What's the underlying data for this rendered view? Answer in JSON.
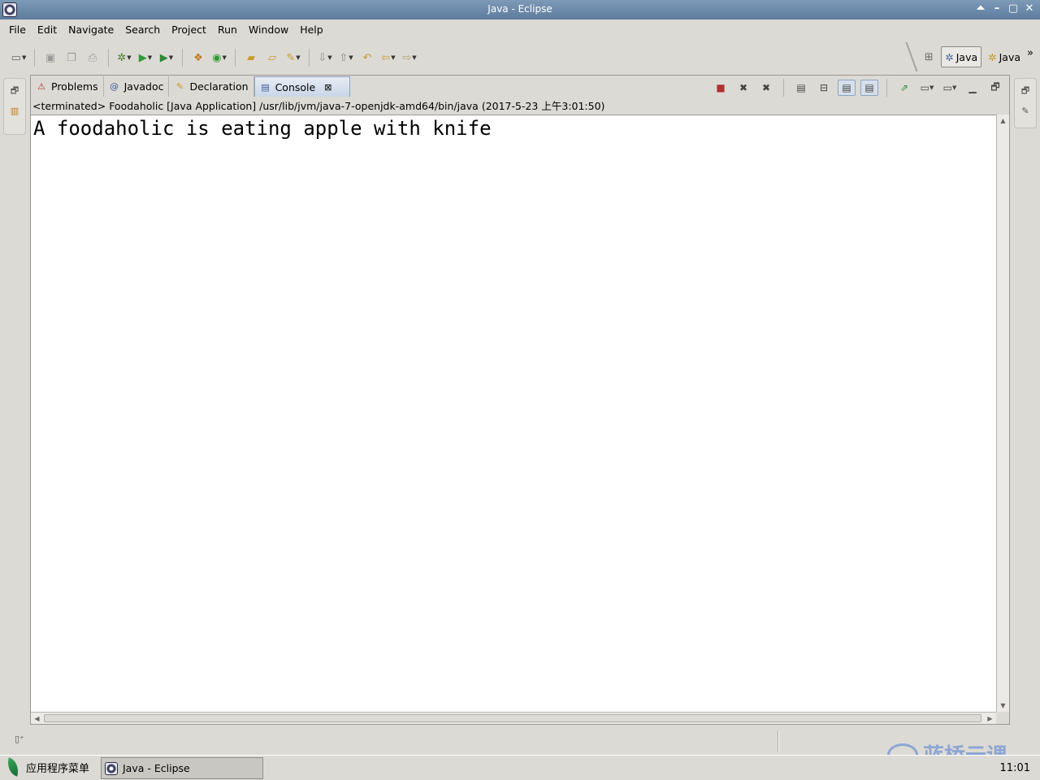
{
  "window": {
    "title": "Java - Eclipse",
    "controls": [
      "⏶",
      "–",
      "▢",
      "✕"
    ]
  },
  "menubar": {
    "items": [
      "File",
      "Edit",
      "Navigate",
      "Search",
      "Project",
      "Run",
      "Window",
      "Help"
    ]
  },
  "toolbar": {
    "icons": [
      "new-icon",
      "save-icon",
      "save-all-icon",
      "print-icon",
      "debug-icon",
      "run-icon",
      "external-tools-icon",
      "new-java-project-icon",
      "new-class-icon",
      "open-type-icon",
      "open-task-icon",
      "search-icon",
      "next-annotation-icon",
      "previous-annotation-icon",
      "last-edit-icon",
      "back-icon",
      "forward-icon"
    ]
  },
  "perspectives": {
    "open_perspective_icon": "open-perspective-icon",
    "items": [
      {
        "label": "Java",
        "active": true
      },
      {
        "label": "Java",
        "active": false
      }
    ],
    "overflow": "»"
  },
  "view": {
    "tabs": [
      {
        "label": "Problems",
        "icon": "problems-icon",
        "glyph": "⚠"
      },
      {
        "label": "Javadoc",
        "icon": "javadoc-icon",
        "glyph": "@"
      },
      {
        "label": "Declaration",
        "icon": "declaration-icon",
        "glyph": "✎"
      },
      {
        "label": "Console",
        "icon": "console-icon",
        "glyph": "▤",
        "active": true
      }
    ],
    "tab_close": "⊠",
    "status_line": "<terminated> Foodaholic [Java Application] /usr/lib/jvm/java-7-openjdk-amd64/bin/java (2017-5-23 上午3:01:50)",
    "console_output": "A foodaholic is eating apple with knife"
  },
  "taskbar": {
    "start_label": "应用程序菜单",
    "task_label": "Java - Eclipse",
    "clock": "11:01"
  },
  "watermark": {
    "text": "蓝桥云课"
  },
  "colors": {
    "titlebar": "#6a88a8",
    "active_tab": "#c9d6e6",
    "background": "#dcdad5"
  }
}
